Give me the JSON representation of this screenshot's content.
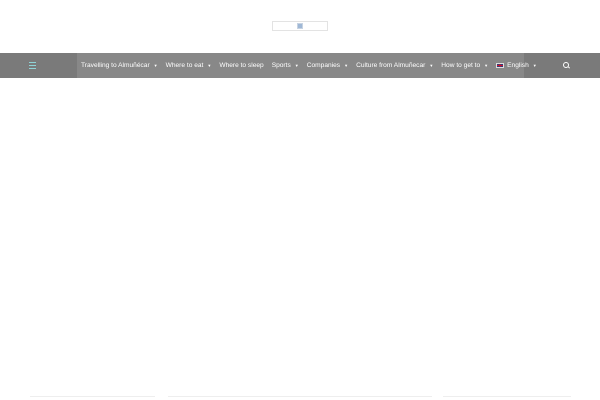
{
  "header": {
    "logo_icon": "site-logo-placeholder"
  },
  "nav": {
    "menu_icon": "hamburger-icon",
    "search_icon": "search-icon",
    "items": [
      {
        "label": "Travelling to Almuñécar",
        "has_dropdown": true
      },
      {
        "label": "Where to eat",
        "has_dropdown": true
      },
      {
        "label": "Where to sleep",
        "has_dropdown": false
      },
      {
        "label": "Sports",
        "has_dropdown": true
      },
      {
        "label": "Companies",
        "has_dropdown": true
      },
      {
        "label": "Culture from Almuñecar",
        "has_dropdown": true
      },
      {
        "label": "How to get to",
        "has_dropdown": true
      }
    ],
    "language": {
      "label": "English",
      "flag_icon": "uk-flag-icon",
      "has_dropdown": true
    },
    "caret_glyph": "▼"
  },
  "colors": {
    "nav_background": "#7a7a7a",
    "nav_active_strip": "#888888",
    "nav_text": "#ffffff",
    "menu_icon_accent": "#8fd3d6"
  }
}
